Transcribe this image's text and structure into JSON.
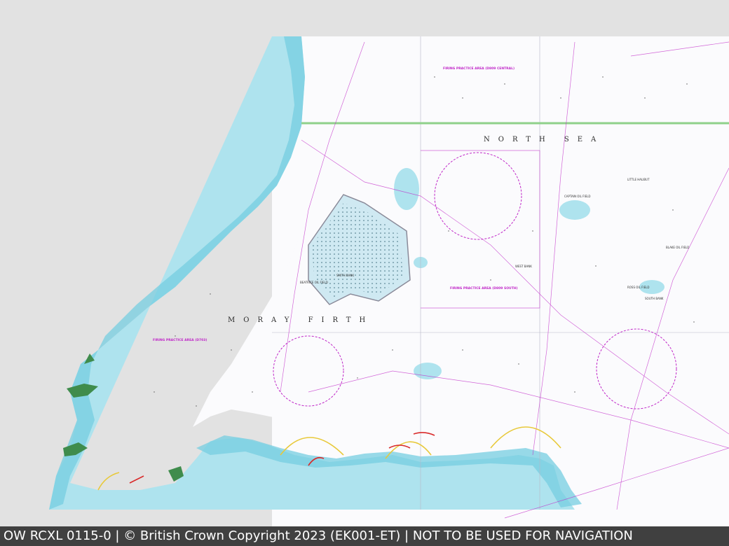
{
  "footer": {
    "text": "OW RCXL 0115-0 | © British Crown Copyright 2023 (EK001-ET) | NOT TO BE USED FOR NAVIGATION"
  },
  "map": {
    "sea_labels": {
      "north_sea": "NORTH SEA",
      "moray_firth": "MORAY FIRTH"
    },
    "firing_areas": {
      "central": "FIRING PRACTICE AREA (D809 CENTRAL)",
      "south": "FIRING PRACTICE AREA (D809 SOUTH)",
      "west": "FIRING PRACTICE AREA (D703)"
    },
    "field_labels": {
      "beatrice": "BEATRICE OIL FIELD",
      "captain": "CAPTAIN OIL FIELD",
      "blake": "BLAKE OIL FIELD",
      "ross": "ROSS OIL FIELD"
    },
    "bank_labels": {
      "little_halibut": "LITTLE HALIBUT",
      "west_bank": "WEST BANK",
      "smith_bank": "SMITH BANK",
      "south_bank": "SOUTH BANK"
    },
    "colors": {
      "land": "#e2e2e2",
      "deep_water": "#ffffff",
      "shallow_water": "#aee3ee",
      "very_shallow": "#75cde0",
      "drying": "#3f8c4c",
      "magenta": "#c027c8",
      "green_line": "#8fd18a",
      "footer_bg": "#404040"
    }
  }
}
